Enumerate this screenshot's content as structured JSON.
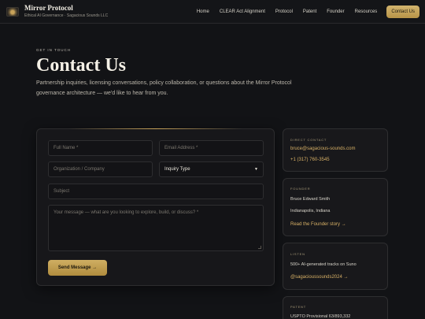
{
  "brand": {
    "title": "Mirror Protocol",
    "subtitle": "Ethical AI Governance · Sagacious Sounds LLC"
  },
  "nav": {
    "items": [
      "Home",
      "CLEAR Act Alignment",
      "Protocol",
      "Patent",
      "Founder",
      "Resources"
    ],
    "cta": "Contact Us",
    "accent_color": "#c8a35a"
  },
  "hero": {
    "eyebrow": "GET IN TOUCH",
    "title": "Contact Us",
    "description": "Partnership inquiries, licensing conversations, policy collaboration, or questions about the Mirror Protocol governance architecture — we'd like to hear from you."
  },
  "form": {
    "full_name_placeholder": "Full Name *",
    "email_placeholder": "Email Address *",
    "organization_placeholder": "Organization / Company",
    "inquiry_type_value": "Inquiry Type",
    "subject_placeholder": "Subject",
    "message_placeholder": "Your message — what are you looking to explore, build, or discuss? *",
    "send_label": "Send Message →"
  },
  "sidebar": {
    "direct_contact": {
      "label": "DIRECT CONTACT",
      "email": "bruce@sagacious-sounds.com",
      "phone": "+1 (317) 760-3545"
    },
    "founder": {
      "label": "FOUNDER",
      "name": "Bruce Edward Smith",
      "location": "Indianapolis, Indiana",
      "link": "Read the Founder story →"
    },
    "listen": {
      "label": "LISTEN",
      "text": "500+ AI-generated tracks on Suno",
      "link": "@sagacioussounds2024 →"
    },
    "patent": {
      "label": "PATENT",
      "text": "USPTO Provisional 63/893,332"
    }
  }
}
